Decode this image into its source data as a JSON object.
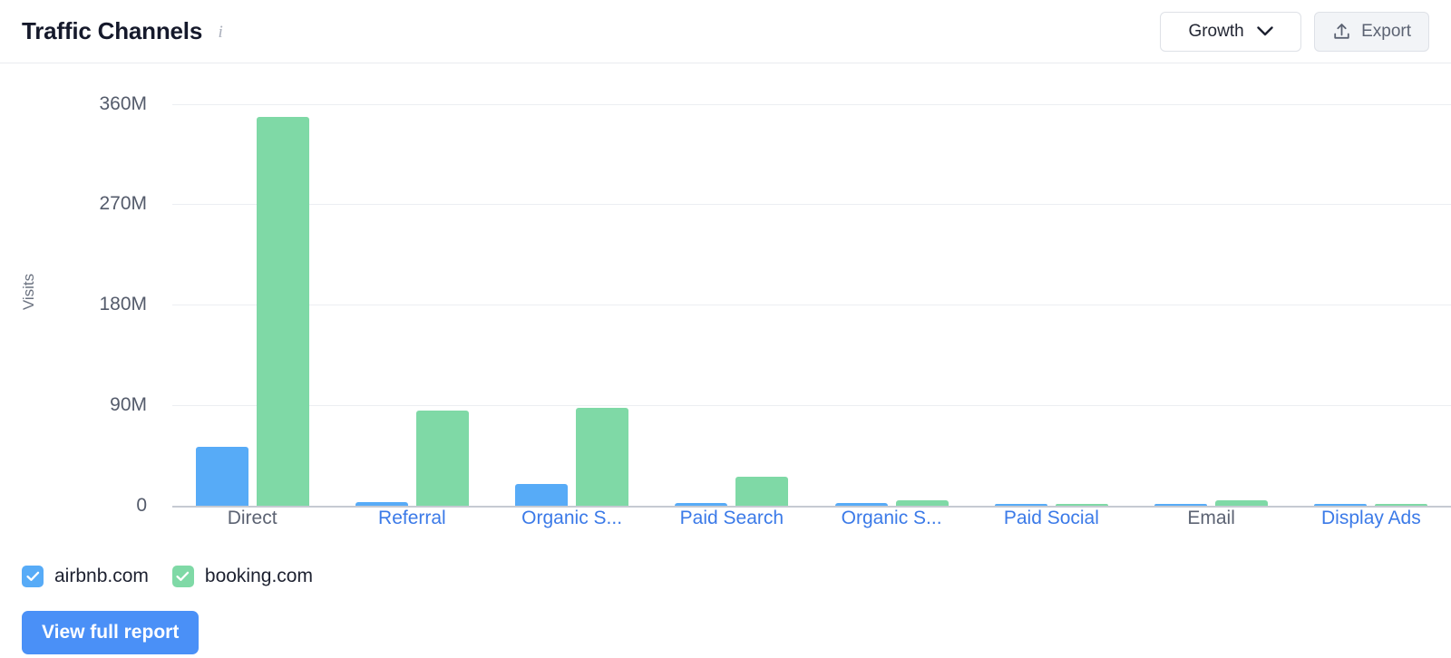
{
  "header": {
    "title": "Traffic Channels",
    "info_icon": "info-icon",
    "growth_dropdown": {
      "label": "Growth",
      "chevron": "chevron-down-icon"
    },
    "export_button": {
      "label": "Export",
      "icon": "upload-icon"
    }
  },
  "legend": {
    "items": [
      {
        "label": "airbnb.com",
        "color": "#57abf7",
        "checked": true
      },
      {
        "label": "booking.com",
        "color": "#7fd9a6",
        "checked": true
      }
    ]
  },
  "footer": {
    "view_full_report_label": "View full report"
  },
  "chart_data": {
    "type": "bar",
    "title": "Traffic Channels",
    "xlabel": "",
    "ylabel": "Visits",
    "ylim": [
      0,
      380
    ],
    "yticks": [
      0,
      90,
      180,
      270,
      360
    ],
    "ytick_labels": [
      "0",
      "90M",
      "180M",
      "270M",
      "360M"
    ],
    "grid": true,
    "legend_position": "bottom-left",
    "unit": "M",
    "categories": [
      "Direct",
      "Referral",
      "Organic S...",
      "Paid Search",
      "Organic S...",
      "Paid Social",
      "Email",
      "Display Ads"
    ],
    "category_is_link": [
      false,
      true,
      true,
      true,
      true,
      true,
      false,
      true
    ],
    "series": [
      {
        "name": "airbnb.com",
        "color": "#57abf7",
        "values": [
          52.5,
          3.5,
          19.5,
          2.5,
          2.5,
          0.4,
          1.2,
          0.3
        ]
      },
      {
        "name": "booking.com",
        "color": "#7fd9a6",
        "values": [
          348,
          85,
          88,
          26,
          5,
          0.4,
          5,
          0.3
        ]
      }
    ]
  }
}
